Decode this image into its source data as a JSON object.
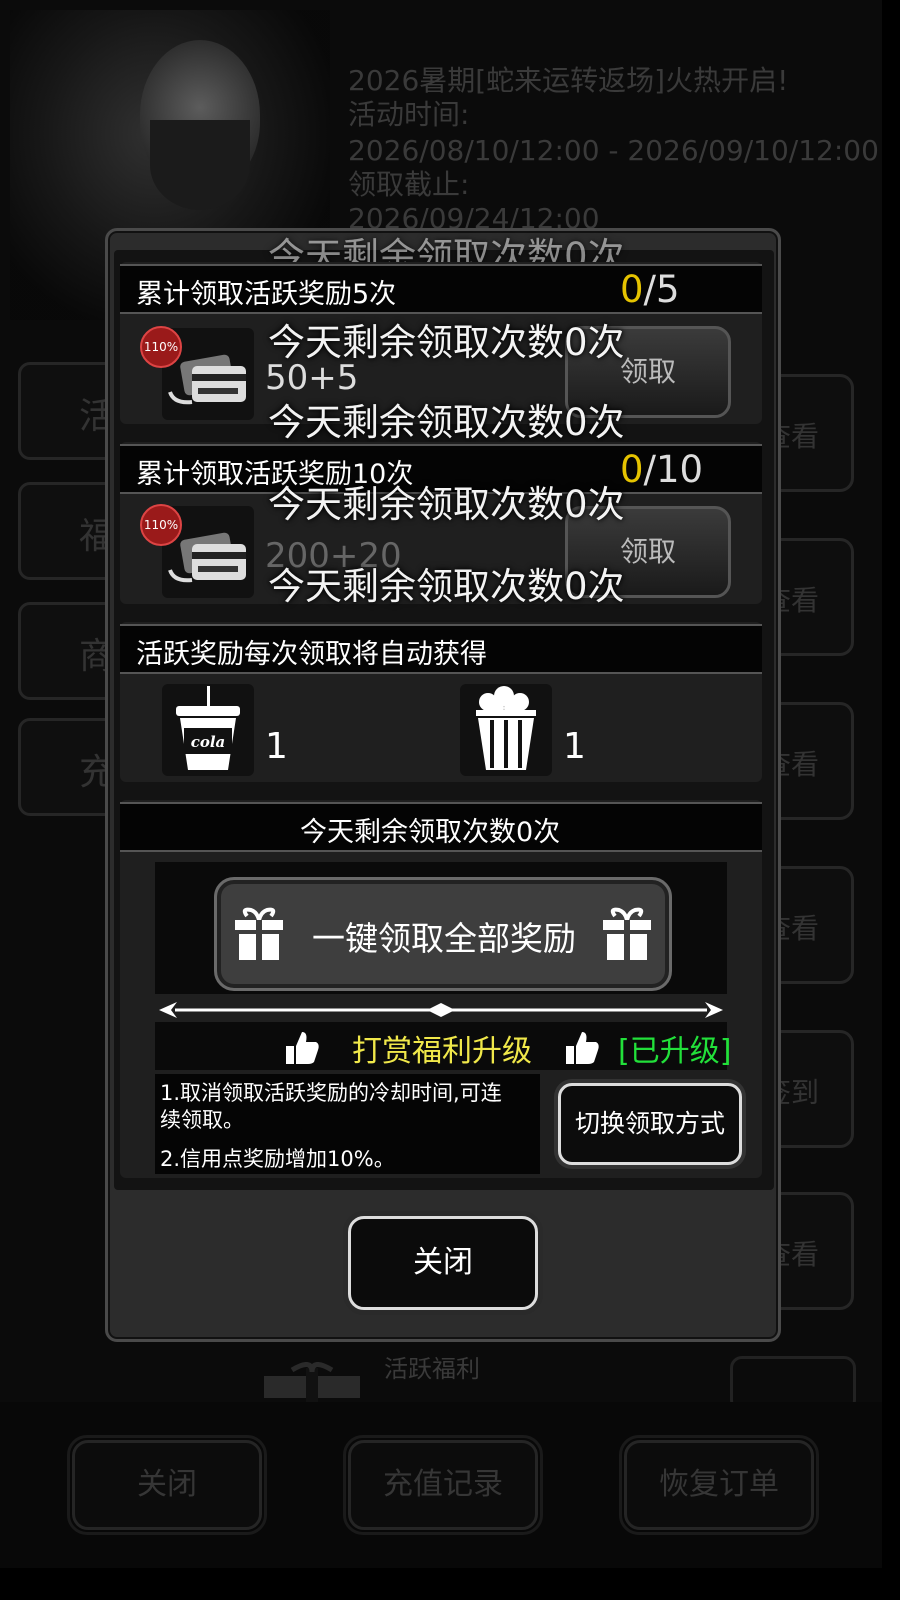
{
  "background": {
    "announcement": {
      "line1": "2026暑期[蛇来运转返场]火热开启!",
      "line2": "活动时间:",
      "line3": "2026/08/10/12:00 - 2026/09/10/12:00",
      "line4": "领取截止:",
      "line5": "2026/09/24/12:00"
    },
    "side_tabs": [
      "活",
      "福",
      "商",
      "充"
    ],
    "right_buttons": [
      "查看",
      "查看",
      "查看",
      "查看",
      "签到",
      "查看"
    ],
    "gift_label": "活跃福利",
    "bottom_buttons": {
      "close": "关闭",
      "recharge_history": "充值记录",
      "restore_order": "恢复订单"
    }
  },
  "modal": {
    "top_overlay": "今天剩余领取次数0次",
    "reward_rows": [
      {
        "title": "累计领取活跃奖励5次",
        "current": "0",
        "total": "/5",
        "badge": "110%",
        "amount": "50+5",
        "claim_label": "领取",
        "overlay_top": "今天剩余领取次数0次",
        "overlay_bottom": "今天剩余领取次数0次"
      },
      {
        "title": "累计领取活跃奖励10次",
        "current": "0",
        "total": "/10",
        "badge": "110%",
        "amount": "200+20",
        "claim_label": "领取",
        "overlay_top": "今天剩余领取次数0次",
        "overlay_bottom": "今天剩余领取次数0次"
      }
    ],
    "auto_section": {
      "title": "活跃奖励每次领取将自动获得",
      "items": [
        {
          "icon": "cola-cup-icon",
          "label": "cola",
          "count": "1"
        },
        {
          "icon": "popcorn-icon",
          "count": "1"
        }
      ]
    },
    "remaining": "今天剩余领取次数0次",
    "claim_all_label": "一键领取全部奖励",
    "upgrade": {
      "title": "打赏福利升级",
      "status": "[已升级]"
    },
    "notes": {
      "line1a": "1.取消领取活跃奖励的冷却时间,可连",
      "line1b": "续领取。",
      "line2": "2.信用点奖励增加10%。"
    },
    "switch_label": "切换领取方式",
    "close_label": "关闭"
  },
  "colors": {
    "counter_current": "#e5c300",
    "upgrade_title": "#f0e84a",
    "upgrade_status": "#22e03a"
  }
}
